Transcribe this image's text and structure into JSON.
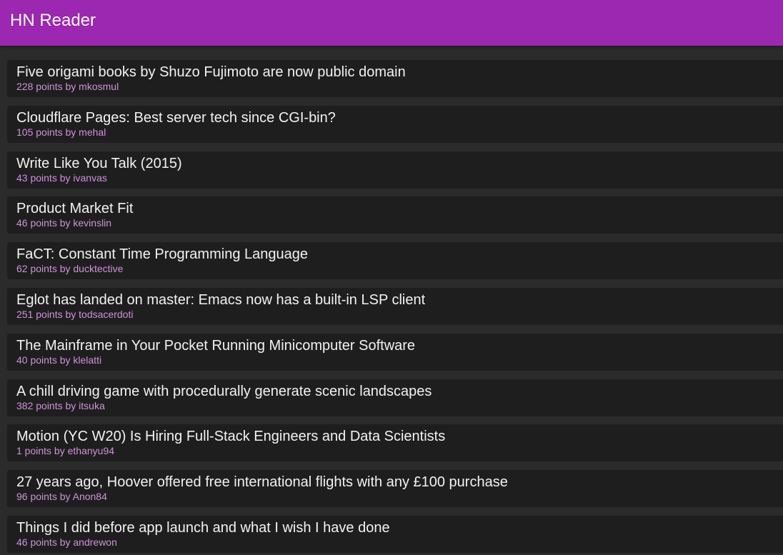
{
  "app": {
    "title": "HN Reader"
  },
  "colors": {
    "app_bar": "#9c27b0",
    "background": "#2b2b2b",
    "card": "#1e1e1e",
    "title_text": "#f2f2f2",
    "meta_text": "#ce93d8"
  },
  "stories": [
    {
      "title": "Five origami books by Shuzo Fujimoto are now public domain",
      "meta": "228 points by mkosmul"
    },
    {
      "title": "Cloudflare Pages: Best server tech since CGI-bin?",
      "meta": "105 points by mehal"
    },
    {
      "title": "Write Like You Talk (2015)",
      "meta": "43 points by ivanvas"
    },
    {
      "title": "Product Market Fit",
      "meta": "46 points by kevinslin"
    },
    {
      "title": "FaCT: Constant Time Programming Language",
      "meta": "62 points by ducktective"
    },
    {
      "title": "Eglot has landed on master: Emacs now has a built-in LSP client",
      "meta": "251 points by todsacerdoti"
    },
    {
      "title": "The Mainframe in Your Pocket Running Minicomputer Software",
      "meta": "40 points by klelatti"
    },
    {
      "title": "A chill driving game with procedurally generate scenic landscapes",
      "meta": "382 points by itsuka"
    },
    {
      "title": "Motion (YC W20) Is Hiring Full-Stack Engineers and Data Scientists",
      "meta": "1 points by ethanyu94"
    },
    {
      "title": "27 years ago, Hoover offered free international flights with any £100 purchase",
      "meta": "96 points by Anon84"
    },
    {
      "title": "Things I did before app launch and what I wish I have done",
      "meta": "46 points by andrewon"
    }
  ]
}
